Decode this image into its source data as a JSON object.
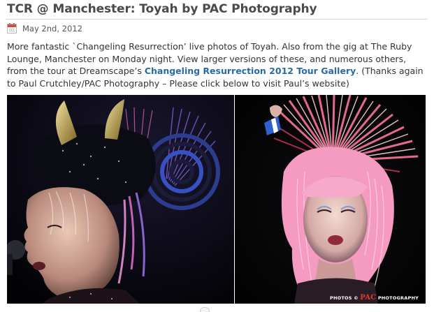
{
  "post": {
    "title": "TCR @ Manchester: Toyah by PAC Photography",
    "date": "May 2nd, 2012",
    "body_before_link": "More fantastic `Changeling Resurrection’ live photos of Toyah. Also from the gig at The Ruby Lounge, Manchester on Monday night. View larger versions of these, and numerous others, from the tour at Dreamscape’s ",
    "link_text": "Changeling Resurrection 2012 Tour Gallery",
    "body_after_link": ". (Thanks again to Paul Crutchley/PAC Photography – Please click below to visit Paul’s website)"
  },
  "photos": {
    "watermark_prefix": "PHOTOS ©",
    "watermark_mark": "PAC",
    "watermark_suffix": "PHOTOGRAPHY"
  },
  "icons": {
    "date_icon": "calendar-icon"
  },
  "colors": {
    "link": "#2a6aa3",
    "title": "#4a4a4a",
    "photo_background": "#050505"
  }
}
